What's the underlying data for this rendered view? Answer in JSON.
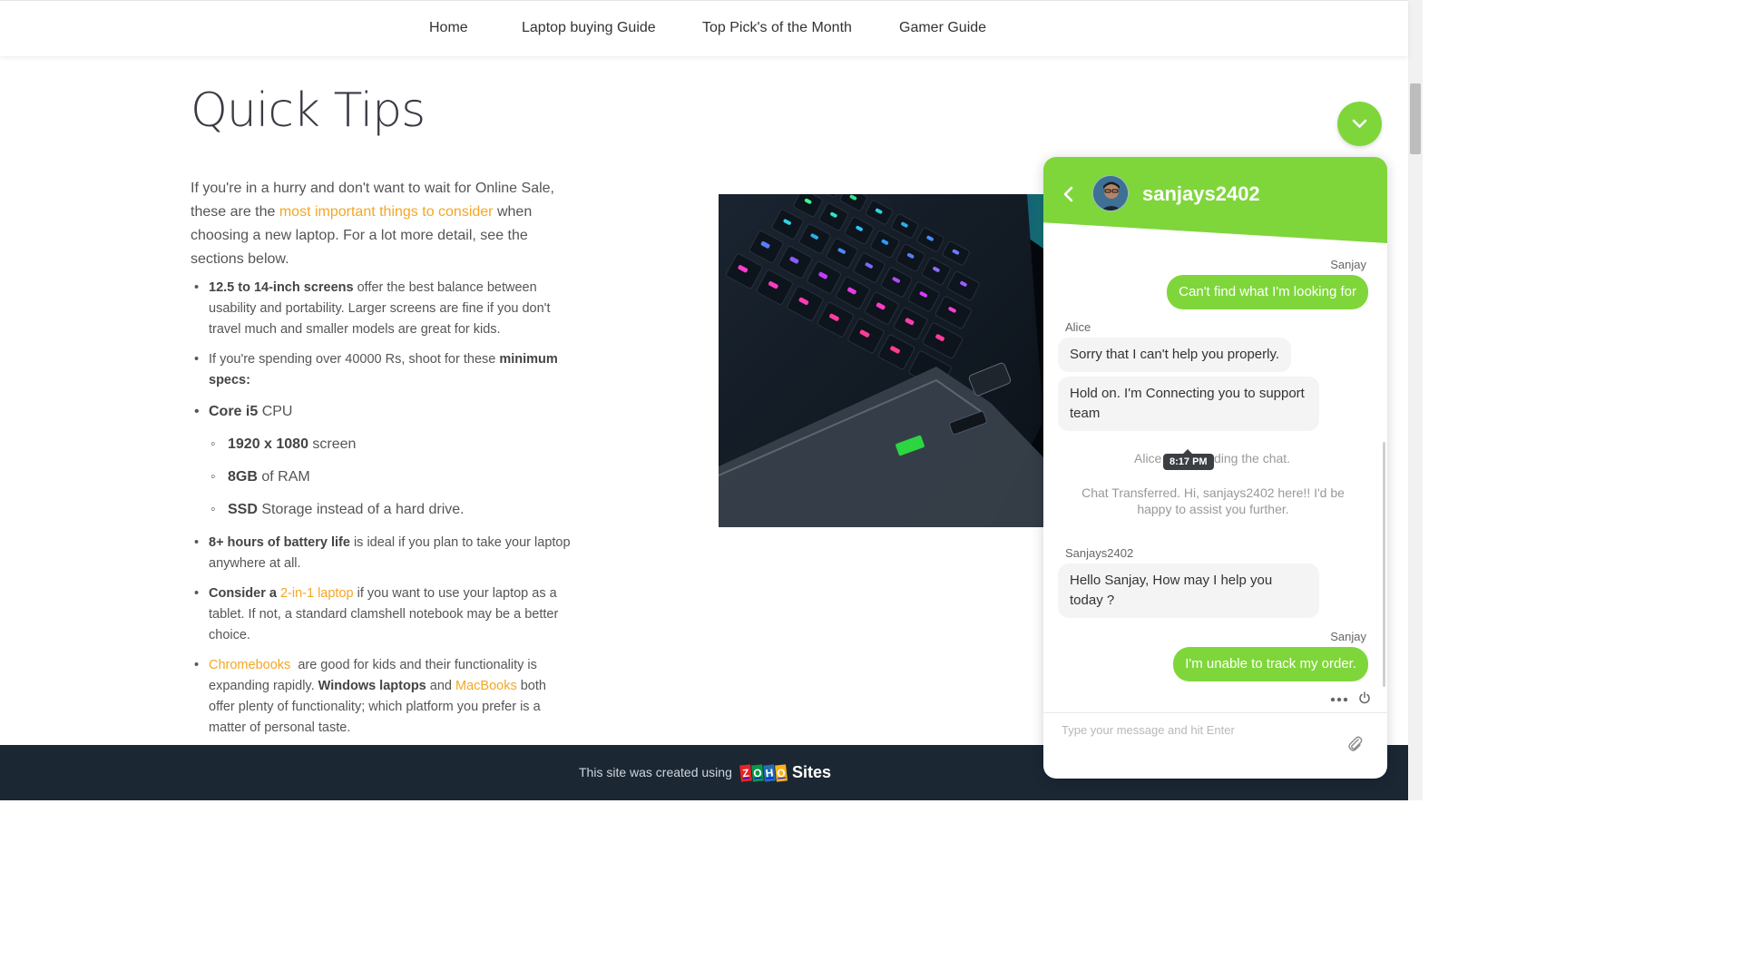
{
  "nav": {
    "items": [
      "Home",
      "Laptop buying Guide",
      "Top Pick's of the Month",
      "Gamer Guide"
    ]
  },
  "content": {
    "title": "Quick Tips",
    "intro_before": "If you're in a hurry and don't want to wait for Online Sale, these are the ",
    "intro_link": "most important things to consider",
    "intro_after": " when choosing a new laptop. For a lot more detail, see the sections below.",
    "tips": {
      "t1_bold": "12.5 to 14-inch screens",
      "t1_rest": " offer the best balance between usability and portability. Larger screens are fine if you don't travel much and smaller models are great for kids.",
      "t2_pre": "If you're spending over 40000 Rs, shoot for these ",
      "t2_bold": "minimum specs:",
      "t3_bold": "Core i5",
      "t3_rest": " CPU",
      "t4_bold": "1920 x 1080",
      "t4_rest": " screen",
      "t5_bold": "8GB",
      "t5_rest": " of RAM",
      "t6_bold": "SSD",
      "t6_rest": " Storage instead of a hard drive.",
      "t7_bold": "8+ hours of battery life",
      "t7_rest": " is ideal if you plan to take your laptop anywhere at all.",
      "t8_bold": "Consider a ",
      "t8_link": "2-in-1 laptop",
      "t8_rest": " if you want to use your laptop as a tablet. If not, a standard clamshell notebook may be a better choice.",
      "t9_link": "Chromebooks",
      "t9_mid": "  are good for kids and their functionality is expanding rapidly. ",
      "t9_bold": "Windows laptops",
      "t9_and": " and ",
      "t9_link2": "MacBooks",
      "t9_rest": " both offer plenty of functionality; which platform you prefer is a matter of personal taste."
    }
  },
  "footer": {
    "text": "This site was created using",
    "zoho_letters": [
      "Z",
      "O",
      "H",
      "O"
    ],
    "sites": "Sites"
  },
  "chat": {
    "agent_name": "sanjays2402",
    "messages": {
      "m1_sender": "Sanjay",
      "m1_text": "Can't find what I'm looking for",
      "m2_sender": "Alice",
      "m2_text": "Sorry that I can't help you properly.",
      "m3_text": "Hold on. I'm Connecting you to support team",
      "sys1_pre": "Alice",
      "sys1_post": "ding the chat.",
      "tooltip": "8:17 PM",
      "sys2": "Chat Transferred. Hi, sanjays2402 here!! I'd be happy to assist you further.",
      "m4_sender": "Sanjays2402",
      "m4_text": "Hello Sanjay, How may I help you today ?",
      "m5_sender": "Sanjay",
      "m5_text": "I'm unable to track my order."
    },
    "input_placeholder": "Type your message and hit Enter"
  },
  "colors": {
    "accent_green": "#7fd63b",
    "link_orange": "#f5a623",
    "footer_bg": "#1b2733"
  }
}
